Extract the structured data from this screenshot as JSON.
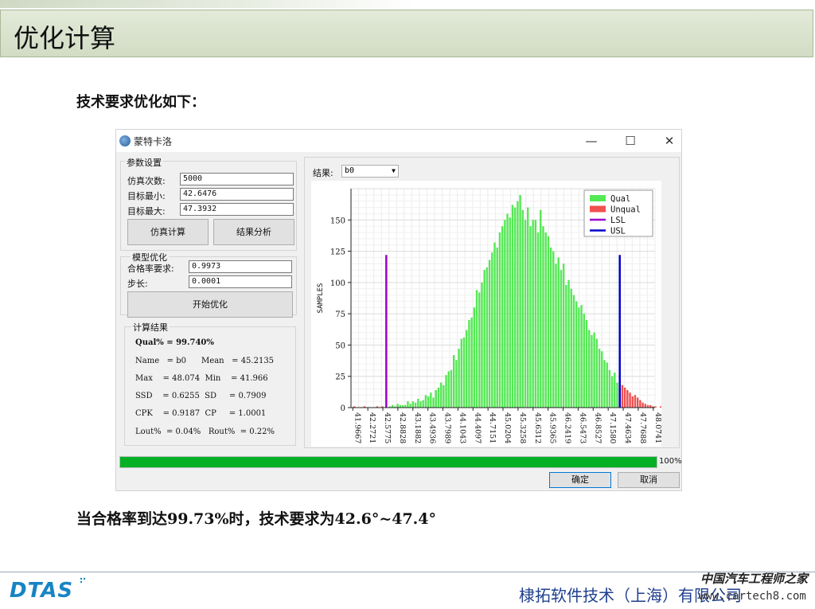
{
  "slide": {
    "title": "优化计算",
    "subtitle": "技术要求优化如下：",
    "conclusion": "当合格率到达99.73%时，技术要求为42.6°~47.4°",
    "company": "棣拓软件技术（上海）有限公司",
    "logo": "DTAS",
    "watermark_cn": "中国汽车工程师之家",
    "watermark_url": "www.cartech8.com"
  },
  "window": {
    "title": "蒙特卡洛",
    "minimize": "—",
    "maximize": "☐",
    "close": "✕"
  },
  "params": {
    "group": "参数设置",
    "sim_count_label": "仿真次数:",
    "sim_count_value": "5000",
    "target_min_label": "目标最小:",
    "target_min_value": "42.6476",
    "target_max_label": "目标最大:",
    "target_max_value": "47.3932",
    "simulate_button": "仿真计算",
    "analyze_button": "结果分析"
  },
  "optimize": {
    "group": "模型优化",
    "rate_label": "合格率要求:",
    "rate_value": "0.9973",
    "step_label": "步长:",
    "step_value": "0.0001",
    "start_button": "开始优化"
  },
  "results": {
    "group": "计算结果",
    "lines": [
      "Qual% = 99.740%",
      "Name   = b0      Mean   = 45.2135",
      "Max    = 48.074  Min    = 41.966",
      "SSD    = 0.6255  SD     = 0.7909",
      "CPK    = 0.9187  CP     = 1.0001",
      "Lout%  = 0.04%   Rout%  = 0.22%"
    ]
  },
  "result_select": {
    "label": "结果:",
    "value": "b0",
    "arrow": "▼"
  },
  "progress": {
    "value": 1.0,
    "text": "100%"
  },
  "dialog_buttons": {
    "ok": "确定",
    "cancel": "取消"
  },
  "colors": {
    "qual": "#55e855",
    "unqual": "#f05050",
    "lsl": "#9900cc",
    "usl": "#0000cc",
    "progress": "#06b025",
    "title_bar": "#d8e0cf",
    "company": "#1f3f8f",
    "logo": "#1784c4"
  },
  "chart_data": {
    "type": "bar",
    "ylabel": "SAMPLES",
    "ylim": [
      0,
      175
    ],
    "yticks": [
      0,
      25,
      50,
      75,
      100,
      125,
      150
    ],
    "xlim": [
      41.93,
      48.11
    ],
    "xticks": [
      "41.9667",
      "42.2721",
      "42.5775",
      "42.8828",
      "43.1882",
      "43.4936",
      "43.7989",
      "44.1043",
      "44.4097",
      "44.7151",
      "45.0204",
      "45.3258",
      "45.6312",
      "45.9365",
      "46.2419",
      "46.5473",
      "46.8527",
      "47.1580",
      "47.4634",
      "47.7688",
      "48.0741"
    ],
    "legend": [
      "Qual",
      "Unqual",
      "LSL",
      "USL"
    ],
    "legend_position": "top-right",
    "grid": true,
    "lsl": 42.6476,
    "usl": 47.3932,
    "bin_width": 0.0519,
    "bin_start": 41.97,
    "counts": [
      1,
      0,
      0,
      0,
      1,
      0,
      0,
      0,
      0,
      1,
      0,
      1,
      0,
      0,
      1,
      2,
      1,
      3,
      2,
      2,
      2,
      5,
      3,
      5,
      4,
      7,
      5,
      6,
      10,
      9,
      12,
      8,
      14,
      16,
      20,
      18,
      26,
      29,
      30,
      42,
      38,
      47,
      55,
      56,
      62,
      70,
      72,
      80,
      94,
      92,
      100,
      110,
      112,
      118,
      124,
      132,
      128,
      140,
      145,
      150,
      155,
      152,
      162,
      160,
      165,
      170,
      158,
      150,
      160,
      145,
      150,
      150,
      140,
      158,
      145,
      140,
      137,
      128,
      125,
      115,
      120,
      110,
      115,
      98,
      102,
      95,
      90,
      85,
      80,
      82,
      75,
      70,
      62,
      58,
      60,
      55,
      47,
      45,
      38,
      36,
      30,
      25,
      28,
      20,
      22,
      18,
      16,
      14,
      12,
      9,
      10,
      8,
      6,
      4,
      3,
      2,
      2,
      1,
      1,
      0,
      1,
      0
    ]
  }
}
